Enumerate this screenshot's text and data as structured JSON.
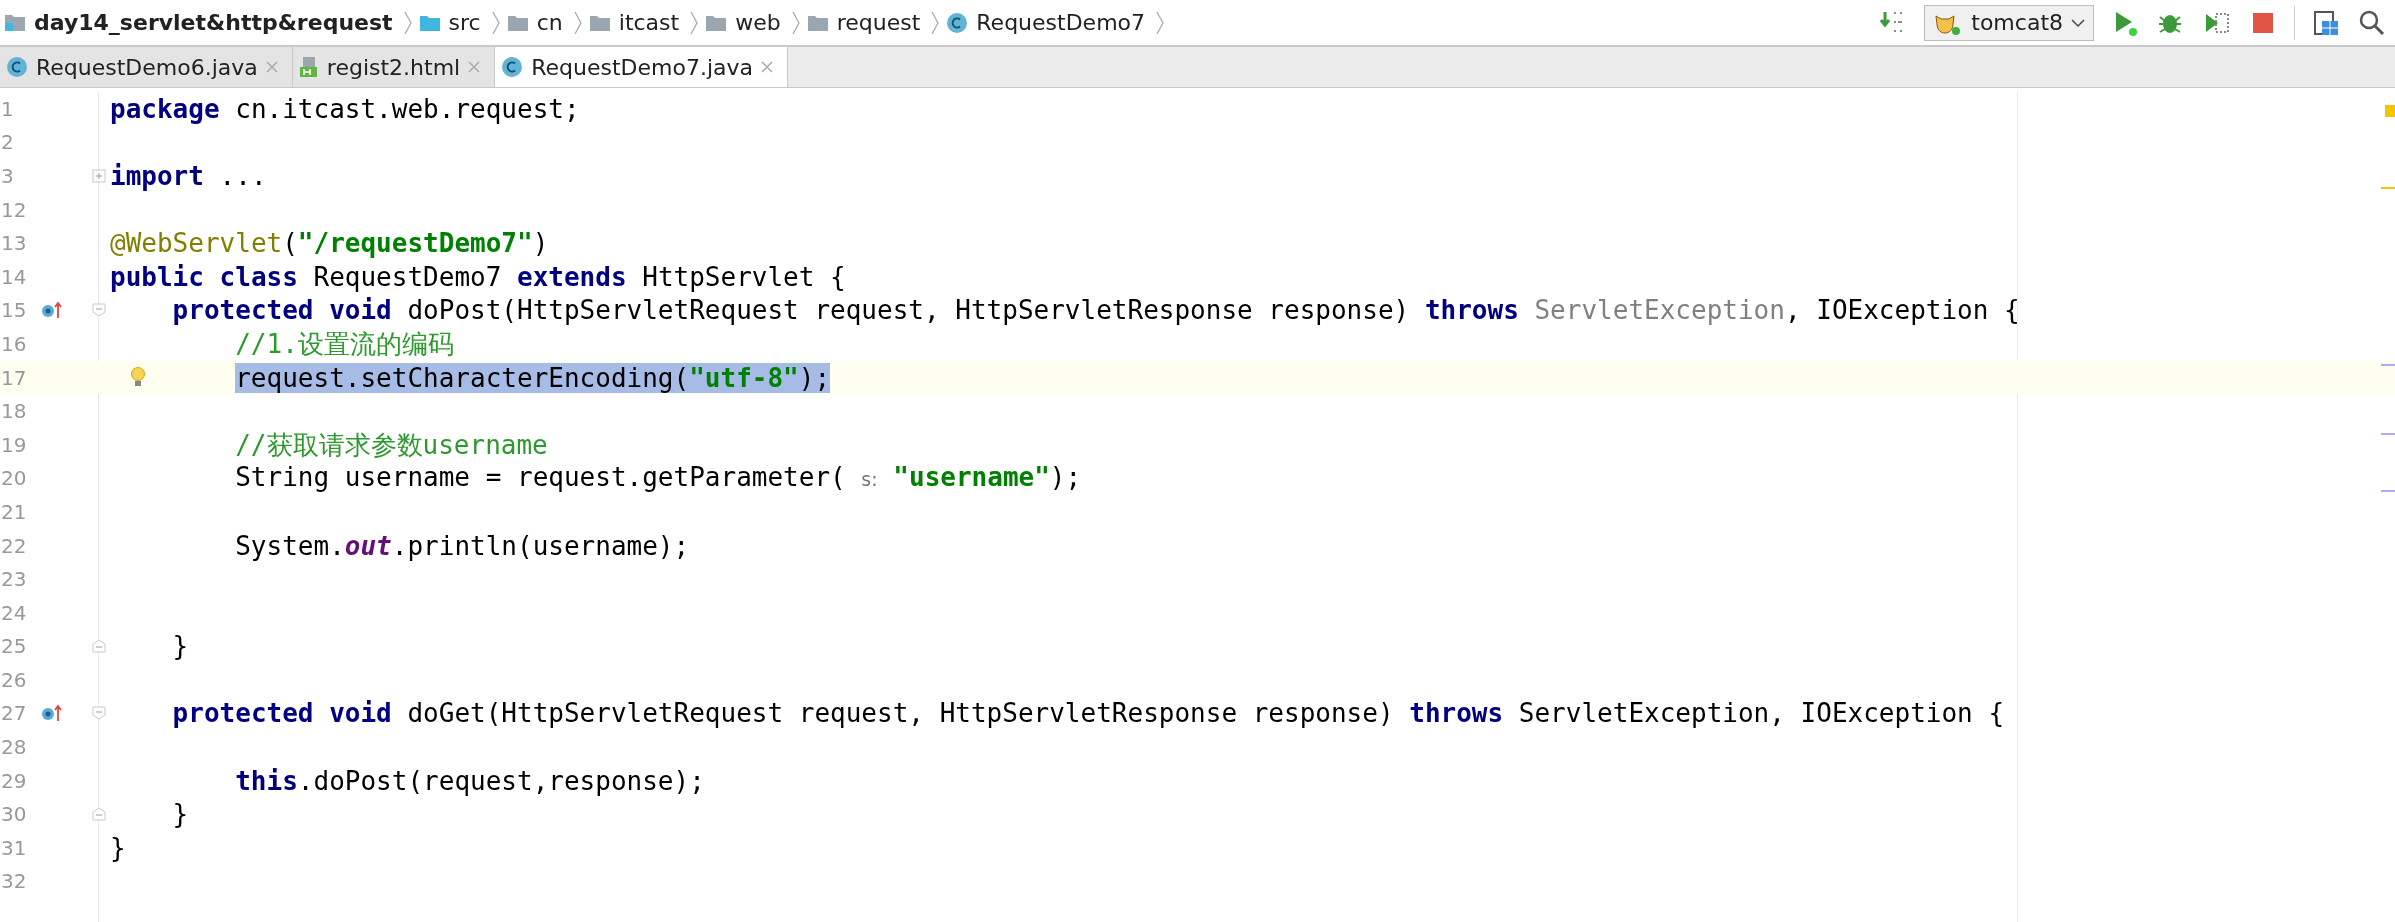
{
  "breadcrumb": [
    {
      "label": "day14_servlet&http&request",
      "kind": "project"
    },
    {
      "label": "src",
      "kind": "source"
    },
    {
      "label": "cn",
      "kind": "folder"
    },
    {
      "label": "itcast",
      "kind": "folder"
    },
    {
      "label": "web",
      "kind": "folder"
    },
    {
      "label": "request",
      "kind": "folder"
    },
    {
      "label": "RequestDemo7",
      "kind": "class"
    }
  ],
  "run_config": {
    "label": "tomcat8"
  },
  "tabs": [
    {
      "label": "RequestDemo6.java",
      "kind": "class",
      "selected": false
    },
    {
      "label": "regist2.html",
      "kind": "html",
      "selected": false
    },
    {
      "label": "RequestDemo7.java",
      "kind": "class",
      "selected": true
    }
  ],
  "lines": [
    {
      "number": "1",
      "selected": false,
      "tokens": [
        {
          "kind": "keyword",
          "text": "package"
        },
        {
          "kind": "plain",
          "text": " cn.itcast.web.request;"
        }
      ]
    },
    {
      "number": "2",
      "selected": false
    },
    {
      "number": "3",
      "selected": false,
      "marks": [
        {
          "kind": "fold-collapsed"
        }
      ],
      "tokens": [
        {
          "kind": "keyword",
          "text": "import"
        },
        {
          "kind": "plain",
          "text": " ..."
        }
      ]
    },
    {
      "number": "12",
      "selected": false
    },
    {
      "number": "13",
      "selected": false,
      "tokens": [
        {
          "kind": "annotation",
          "text": "@WebServlet"
        },
        {
          "kind": "plain",
          "text": "("
        },
        {
          "kind": "string",
          "text": "\"/requestDemo7\""
        },
        {
          "kind": "plain",
          "text": ")"
        }
      ]
    },
    {
      "number": "14",
      "selected": false,
      "tokens": [
        {
          "kind": "keyword",
          "text": "public class"
        },
        {
          "kind": "plain",
          "text": " RequestDemo7 "
        },
        {
          "kind": "keyword",
          "text": "extends"
        },
        {
          "kind": "plain",
          "text": " HttpServlet {"
        }
      ],
      "children": [
        {
          "number": "15",
          "selected": false,
          "marks": [
            {
              "kind": "override"
            },
            {
              "kind": "fold-open"
            }
          ],
          "tokens": [
            {
              "kind": "keyword",
              "text": "protected void"
            },
            {
              "kind": "plain",
              "text": " doPost(HttpServletRequest request, HttpServletResponse response) "
            },
            {
              "kind": "keyword",
              "text": "throws"
            },
            {
              "kind": "muted",
              "text": " ServletException"
            },
            {
              "kind": "plain",
              "text": ", IOException {"
            }
          ],
          "children": [
            {
              "number": "16",
              "selected": false,
              "tokens": [
                {
                  "kind": "comment",
                  "text": "//1.设置流的编码"
                }
              ]
            },
            {
              "number": "17",
              "selected": true,
              "marks": [
                {
                  "kind": "bulb"
                }
              ],
              "tokens": [
                {
                  "kind": "plain",
                  "text": "request.setCharacterEncoding("
                },
                {
                  "kind": "string",
                  "text": "\"utf-8\""
                },
                {
                  "kind": "plain",
                  "text": ");"
                }
              ]
            },
            {
              "number": "18",
              "selected": false
            },
            {
              "number": "19",
              "selected": false,
              "tokens": [
                {
                  "kind": "comment",
                  "text": "//获取请求参数username"
                }
              ]
            },
            {
              "number": "20",
              "selected": false,
              "tokens": [
                {
                  "kind": "plain",
                  "text": "String username = request.getParameter( "
                },
                {
                  "kind": "hint",
                  "text": "s:"
                },
                {
                  "kind": "string",
                  "text": " \"username\""
                },
                {
                  "kind": "plain",
                  "text": ");"
                }
              ]
            },
            {
              "number": "21",
              "selected": false
            },
            {
              "number": "22",
              "selected": false,
              "tokens": [
                {
                  "kind": "plain",
                  "text": "System."
                },
                {
                  "kind": "field",
                  "text": "out"
                },
                {
                  "kind": "plain",
                  "text": ".println(username);"
                }
              ]
            },
            {
              "number": "23",
              "selected": false
            },
            {
              "number": "24",
              "selected": false
            }
          ]
        },
        {
          "number": "25",
          "selected": false,
          "marks": [
            {
              "kind": "fold-end"
            }
          ],
          "tokens": [
            {
              "kind": "plain",
              "text": "}"
            }
          ]
        },
        {
          "number": "26",
          "selected": false
        },
        {
          "number": "27",
          "selected": false,
          "marks": [
            {
              "kind": "override"
            },
            {
              "kind": "fold-open"
            }
          ],
          "tokens": [
            {
              "kind": "keyword",
              "text": "protected void"
            },
            {
              "kind": "plain",
              "text": " doGet(HttpServletRequest request, HttpServletResponse response) "
            },
            {
              "kind": "keyword",
              "text": "throws"
            },
            {
              "kind": "plain",
              "text": " ServletException, IOException {"
            }
          ],
          "children": [
            {
              "number": "28",
              "selected": false
            },
            {
              "number": "29",
              "selected": false,
              "tokens": [
                {
                  "kind": "keyword",
                  "text": "this"
                },
                {
                  "kind": "plain",
                  "text": ".doPost(request,response);"
                }
              ]
            }
          ]
        },
        {
          "number": "30",
          "selected": false,
          "marks": [
            {
              "kind": "fold-end"
            }
          ],
          "tokens": [
            {
              "kind": "plain",
              "text": "}"
            }
          ]
        }
      ]
    },
    {
      "number": "31",
      "selected": false,
      "tokens": [
        {
          "kind": "plain",
          "text": "}"
        }
      ]
    },
    {
      "number": "32",
      "selected": false
    }
  ]
}
